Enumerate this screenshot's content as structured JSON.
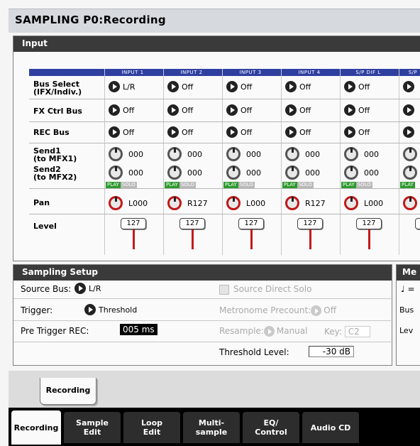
{
  "title": "SAMPLING P0:Recording",
  "input_section": {
    "header": "Input",
    "columns": [
      "INPUT 1",
      "INPUT 2",
      "INPUT 3",
      "INPUT 4",
      "S/P DIF L",
      "S/P"
    ],
    "row_labels": {
      "bus_select": "Bus Select\n(IFX/Indiv.)",
      "fx_ctrl_bus": "FX Ctrl Bus",
      "rec_bus": "REC Bus",
      "send1": "Send1\n(to MFX1)",
      "send2": "Send2\n(to MFX2)",
      "pan": "Pan",
      "level": "Level"
    },
    "bus_select": [
      "L/R",
      "Off",
      "Off",
      "Off",
      "Off",
      ""
    ],
    "fx_ctrl_bus": [
      "Off",
      "Off",
      "Off",
      "Off",
      "Off",
      ""
    ],
    "rec_bus": [
      "Off",
      "Off",
      "Off",
      "Off",
      "Off",
      ""
    ],
    "send1": [
      "000",
      "000",
      "000",
      "000",
      "000",
      ""
    ],
    "send2": [
      "000",
      "000",
      "000",
      "000",
      "000",
      ""
    ],
    "play_label": "PLAY",
    "solo_label": "SOLO",
    "pan": [
      "L000",
      "R127",
      "L000",
      "R127",
      "L000",
      ""
    ],
    "level": [
      "127",
      "127",
      "127",
      "127",
      "127",
      "1"
    ]
  },
  "sampling_setup": {
    "header": "Sampling Setup",
    "source_bus_label": "Source Bus:",
    "source_bus_value": "L/R",
    "source_direct_solo_label": "Source Direct Solo",
    "trigger_label": "Trigger:",
    "trigger_value": "Threshold",
    "metronome_precount_label": "Metronome Precount:",
    "metronome_precount_value": "Off",
    "pre_trigger_label": "Pre Trigger REC:",
    "pre_trigger_value": "005",
    "pre_trigger_unit": "ms",
    "resample_label": "Resample:",
    "resample_value": "Manual",
    "key_label": "Key:",
    "key_value": "C2",
    "threshold_label": "Threshold Level:",
    "threshold_value": "-30 dB"
  },
  "metronome_panel": {
    "header": "Me",
    "note_symbol": "♩ =",
    "bus_label": "Bus",
    "level_label": "Lev"
  },
  "subtab_label": "Recording",
  "tabs": [
    {
      "label": "Recording",
      "active": true
    },
    {
      "label": "Sample\nEdit",
      "active": false
    },
    {
      "label": "Loop\nEdit",
      "active": false
    },
    {
      "label": "Multi-\nsample",
      "active": false
    },
    {
      "label": "EQ/\nControl",
      "active": false
    },
    {
      "label": "Audio CD",
      "active": false
    }
  ],
  "colors": {
    "header_blue": "#2f3fa0",
    "level_red": "#c21a1a",
    "play_green": "#2e9a2e"
  }
}
